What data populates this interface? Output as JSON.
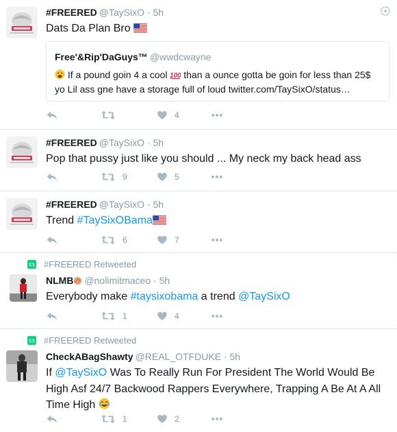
{
  "tweets": [
    {
      "name": "#FREERED",
      "handle": "@TaySixO",
      "time": "5h",
      "text": "Dats Da Plan Bro",
      "quote": {
        "name": "Free'&Rip'DaGuys™",
        "handle": "@wwdcwayne",
        "line1": "If a pound goin 4 a cool",
        "line1b": "than a ounce gotta be goin for less than 25$",
        "line2": "yo Lil ass gne have a storage full of loud twitter.com/TaySixO/status…"
      },
      "retweets": "",
      "likes": "4"
    },
    {
      "name": "#FREERED",
      "handle": "@TaySixO",
      "time": "5h",
      "text": "Pop that pussy just like you should ... My neck my back head ass",
      "retweets": "9",
      "likes": "5"
    },
    {
      "name": "#FREERED",
      "handle": "@TaySixO",
      "time": "5h",
      "text_prefix": "Trend",
      "text_link": "#TaySixOBama",
      "retweets": "6",
      "likes": "7"
    },
    {
      "retweeted_by": "#FREERED Retweeted",
      "name": "NLMB",
      "handle": "@nolimitmaceo",
      "time": "5h",
      "text_prefix": "Everybody make",
      "text_link": "#taysixobama",
      "text_middle": "a trend",
      "text_link2": "@TaySixO",
      "retweets": "1",
      "likes": "4"
    },
    {
      "retweeted_by": "#FREERED Retweeted",
      "name": "CheckABagShawty",
      "handle": "@REAL_OTFDUKE",
      "time": "5h",
      "text_prefix": "If",
      "text_link": "@TaySixO",
      "text_rest": "Was To Really Run For President The World Would Be High Asf 24/7 Backwood Rappers Everywhere, Trapping A Be At A All Time High",
      "retweets": "1",
      "likes": "2"
    }
  ],
  "dot": "·",
  "icons": {
    "reply": "reply-icon",
    "retweet": "retweet-icon",
    "like": "heart-icon",
    "more": "more-icon",
    "settings": "settings-icon",
    "flag": "us-flag-icon",
    "hundred": "hundred-points-emoji",
    "weary": "weary-face-emoji",
    "muscle": "flexed-biceps-emoji",
    "laugh": "tears-of-joy-emoji"
  },
  "colors": {
    "link": "#1b95e0",
    "muted": "#8899a6",
    "icon": "#aab8c2",
    "retweet_green": "#19cf86",
    "border": "#e1e8ed"
  }
}
